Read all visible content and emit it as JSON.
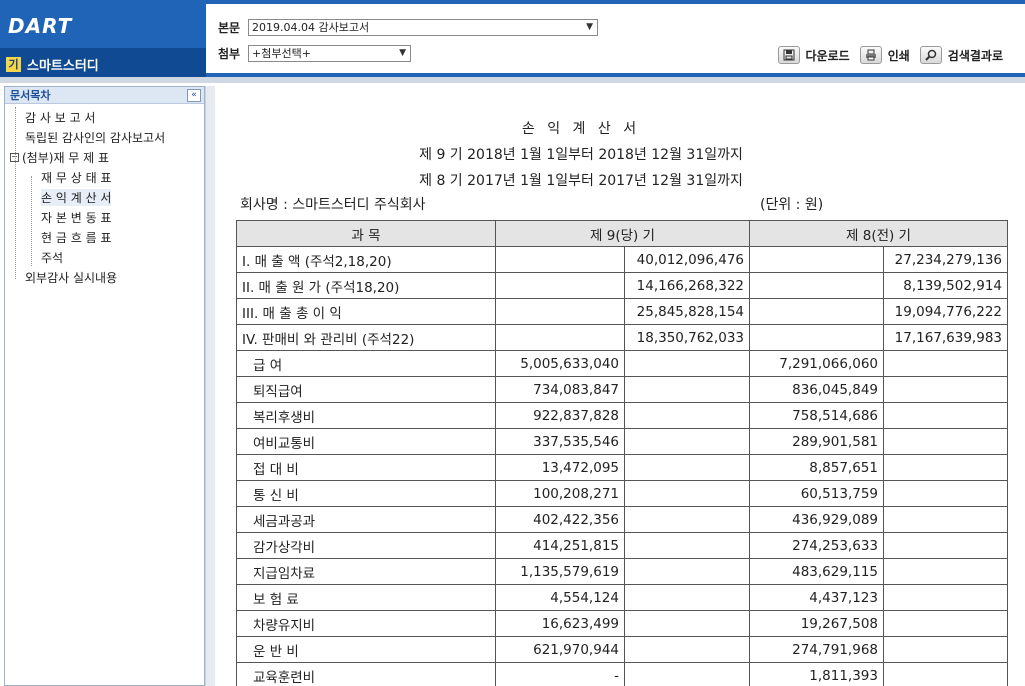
{
  "header": {
    "logo_text": "DART",
    "company_badge": "기",
    "company_name": "스마트스터디",
    "main_label": "본문",
    "main_select_value": "2019.04.04 감사보고서",
    "attach_label": "첨부",
    "attach_select_value": "+첨부선택+",
    "tools": {
      "download": "다운로드",
      "print": "인쇄",
      "search_results": "검색결과로"
    }
  },
  "sidebar": {
    "title": "문서목차",
    "collapse_glyph": "«",
    "items": [
      {
        "label": "감 사 보 고 서"
      },
      {
        "label": "독립된 감사인의 감사보고서"
      },
      {
        "label": "(첨부)재 무 제 표",
        "expander": "−"
      },
      {
        "label": "재 무 상 태 표"
      },
      {
        "label": "손 익 계 산 서"
      },
      {
        "label": "자 본 변 동 표"
      },
      {
        "label": "현 금 흐 름 표"
      },
      {
        "label": "주석"
      },
      {
        "label": "외부감사 실시내용"
      }
    ]
  },
  "document": {
    "title": "손 익 계 산 서",
    "period_current": "제 9 기 2018년 1월 1일부터 2018년 12월 31일까지",
    "period_prior": "제 8 기 2017년 1월 1일부터 2017년 12월 31일까지",
    "company": "회사명 : 스마트스터디 주식회사",
    "unit": "(단위 : 원)",
    "table": {
      "col_item": "과                목",
      "col_current": "제 9(당) 기",
      "col_prior": "제 8(전) 기",
      "rows": [
        {
          "item": "I. 매 출 액 (주석2,18,20)",
          "c1": "",
          "c2": "40,012,096,476",
          "p1": "",
          "p2": "27,234,279,136"
        },
        {
          "item": "II. 매 출 원 가 (주석18,20)",
          "c1": "",
          "c2": "14,166,268,322",
          "p1": "",
          "p2": "8,139,502,914"
        },
        {
          "item": "III. 매 출 총 이 익",
          "c1": "",
          "c2": "25,845,828,154",
          "p1": "",
          "p2": "19,094,776,222"
        },
        {
          "item": "IV. 판매비 와 관리비 (주석22)",
          "c1": "",
          "c2": "18,350,762,033",
          "p1": "",
          "p2": "17,167,639,983"
        },
        {
          "item": "급 여",
          "c1": "5,005,633,040",
          "c2": "",
          "p1": "7,291,066,060",
          "p2": "",
          "sub": true
        },
        {
          "item": "퇴직급여",
          "c1": "734,083,847",
          "c2": "",
          "p1": "836,045,849",
          "p2": "",
          "sub": true
        },
        {
          "item": "복리후생비",
          "c1": "922,837,828",
          "c2": "",
          "p1": "758,514,686",
          "p2": "",
          "sub": true
        },
        {
          "item": "여비교통비",
          "c1": "337,535,546",
          "c2": "",
          "p1": "289,901,581",
          "p2": "",
          "sub": true
        },
        {
          "item": "접 대 비",
          "c1": "13,472,095",
          "c2": "",
          "p1": "8,857,651",
          "p2": "",
          "sub": true
        },
        {
          "item": "통 신 비",
          "c1": "100,208,271",
          "c2": "",
          "p1": "60,513,759",
          "p2": "",
          "sub": true
        },
        {
          "item": "세금과공과",
          "c1": "402,422,356",
          "c2": "",
          "p1": "436,929,089",
          "p2": "",
          "sub": true
        },
        {
          "item": "감가상각비",
          "c1": "414,251,815",
          "c2": "",
          "p1": "274,253,633",
          "p2": "",
          "sub": true
        },
        {
          "item": "지급임차료",
          "c1": "1,135,579,619",
          "c2": "",
          "p1": "483,629,115",
          "p2": "",
          "sub": true
        },
        {
          "item": "보 험 료",
          "c1": "4,554,124",
          "c2": "",
          "p1": "4,437,123",
          "p2": "",
          "sub": true
        },
        {
          "item": "차량유지비",
          "c1": "16,623,499",
          "c2": "",
          "p1": "19,267,508",
          "p2": "",
          "sub": true
        },
        {
          "item": "운 반 비",
          "c1": "621,970,944",
          "c2": "",
          "p1": "274,791,968",
          "p2": "",
          "sub": true
        },
        {
          "item": "교육훈련비",
          "c1": "-",
          "c2": "",
          "p1": "1,811,393",
          "p2": "",
          "sub": true
        }
      ]
    }
  }
}
